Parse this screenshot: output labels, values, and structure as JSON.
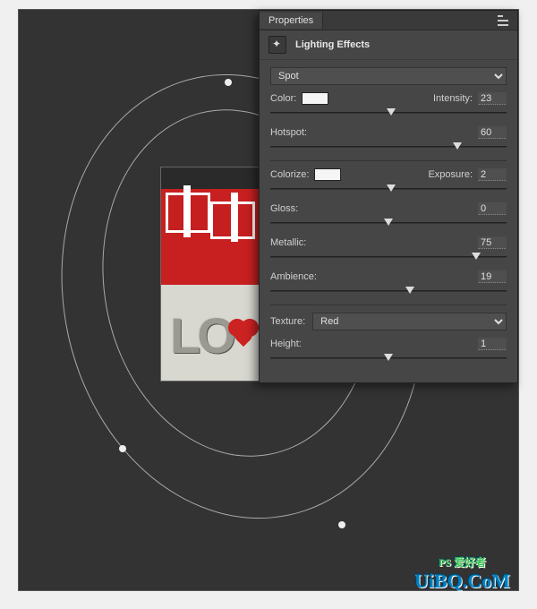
{
  "panel": {
    "title": "Properties",
    "section_title": "Lighting Effects",
    "light_type": "Spot",
    "color": {
      "label": "Color:",
      "hex": "#f5f5f5"
    },
    "intensity": {
      "label": "Intensity:",
      "value": "23",
      "pos": 51
    },
    "hotspot": {
      "label": "Hotspot:",
      "value": "60",
      "pos": 79
    },
    "colorize": {
      "label": "Colorize:",
      "hex": "#f2f2f2"
    },
    "exposure": {
      "label": "Exposure:",
      "value": "2",
      "pos": 51
    },
    "gloss": {
      "label": "Gloss:",
      "value": "0",
      "pos": 50
    },
    "metallic": {
      "label": "Metallic:",
      "value": "75",
      "pos": 87
    },
    "ambience": {
      "label": "Ambience:",
      "value": "19",
      "pos": 59
    },
    "texture": {
      "label": "Texture:",
      "value": "Red"
    },
    "height": {
      "label": "Height:",
      "value": "1",
      "pos": 50
    }
  },
  "watermark": {
    "line1": "PS 爱好者",
    "line2": "UiBQ.CoM"
  }
}
